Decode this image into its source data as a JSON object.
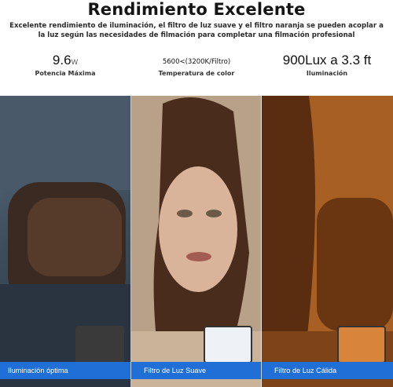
{
  "header": {
    "title": "Rendimiento Excelente",
    "subtitle": "Excelente rendimiento de iluminación, el filtro de luz suave y el filtro naranja se pueden acoplar a la luz según las necesidades de filmación para completar una filmación profesional"
  },
  "specs": [
    {
      "value": "9.6",
      "unit": "W",
      "label": "Potencia Máxima"
    },
    {
      "value": "5600<(3200K/Filtro)",
      "label": "Temperatura de color"
    },
    {
      "value": "900Lux a 3.3 ft",
      "label": "Iluminación"
    }
  ],
  "panels": [
    {
      "caption": "Iluminación óptima",
      "lamp_color": "#3a3a3a"
    },
    {
      "caption": "Filtro de Luz Suave",
      "lamp_color": "#eef2f7"
    },
    {
      "caption": "Filtro de Luz Cálida",
      "lamp_color": "#d8843a"
    }
  ],
  "colors": {
    "caption_bar": "#1f6fd6"
  }
}
